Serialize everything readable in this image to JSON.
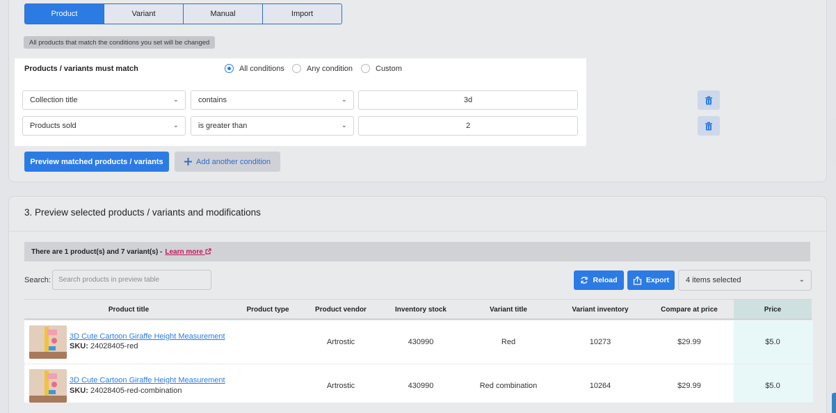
{
  "tabs": [
    {
      "label": "Product",
      "active": true
    },
    {
      "label": "Variant",
      "active": false
    },
    {
      "label": "Manual",
      "active": false
    },
    {
      "label": "Import",
      "active": false
    }
  ],
  "note": "All products that match the conditions you set will be changed",
  "match": {
    "label": "Products / variants must match",
    "options": [
      {
        "label": "All conditions",
        "checked": true
      },
      {
        "label": "Any condition",
        "checked": false
      },
      {
        "label": "Custom",
        "checked": false
      }
    ]
  },
  "conditions": [
    {
      "field": "Collection title",
      "operator": "contains",
      "value": "3d"
    },
    {
      "field": "Products sold",
      "operator": "is greater than",
      "value": "2"
    }
  ],
  "buttons": {
    "preview": "Preview matched products / variants",
    "add_condition": "Add another condition",
    "reload": "Reload",
    "export": "Export"
  },
  "section": {
    "title": "3. Preview selected products / variants and modifications",
    "info_text": "There are 1 product(s) and 7 variant(s) -",
    "learn_more": "Learn more"
  },
  "search": {
    "label": "Search:",
    "placeholder": "Search products in preview table"
  },
  "items_selected": "4 items selected",
  "table": {
    "headers": [
      "Product title",
      "Product type",
      "Product vendor",
      "Inventory stock",
      "Variant title",
      "Variant inventory",
      "Compare at price",
      "Price"
    ],
    "rows": [
      {
        "title": "3D Cute Cartoon Giraffe Height Measurement",
        "sku_label": "SKU:",
        "sku": "24028405-red",
        "type": "",
        "vendor": "Artrostic",
        "stock": "430990",
        "variant": "Red",
        "variant_inventory": "10273",
        "compare": "$29.99",
        "price": "$5.0"
      },
      {
        "title": "3D Cute Cartoon Giraffe Height Measurement",
        "sku_label": "SKU:",
        "sku": "24028405-red-combination",
        "type": "",
        "vendor": "Artrostic",
        "stock": "430990",
        "variant": "Red combination",
        "variant_inventory": "10264",
        "compare": "$29.99",
        "price": "$5.0"
      }
    ]
  },
  "colors": {
    "accent": "#2c7be5",
    "link_pink": "#c2185b",
    "price_col": "#e8f7f7"
  },
  "icons": {
    "chevron": "chevron-down-icon",
    "trash": "trash-icon",
    "plus": "plus-icon",
    "reload": "reload-icon",
    "export": "export-icon",
    "external": "external-link-icon"
  }
}
